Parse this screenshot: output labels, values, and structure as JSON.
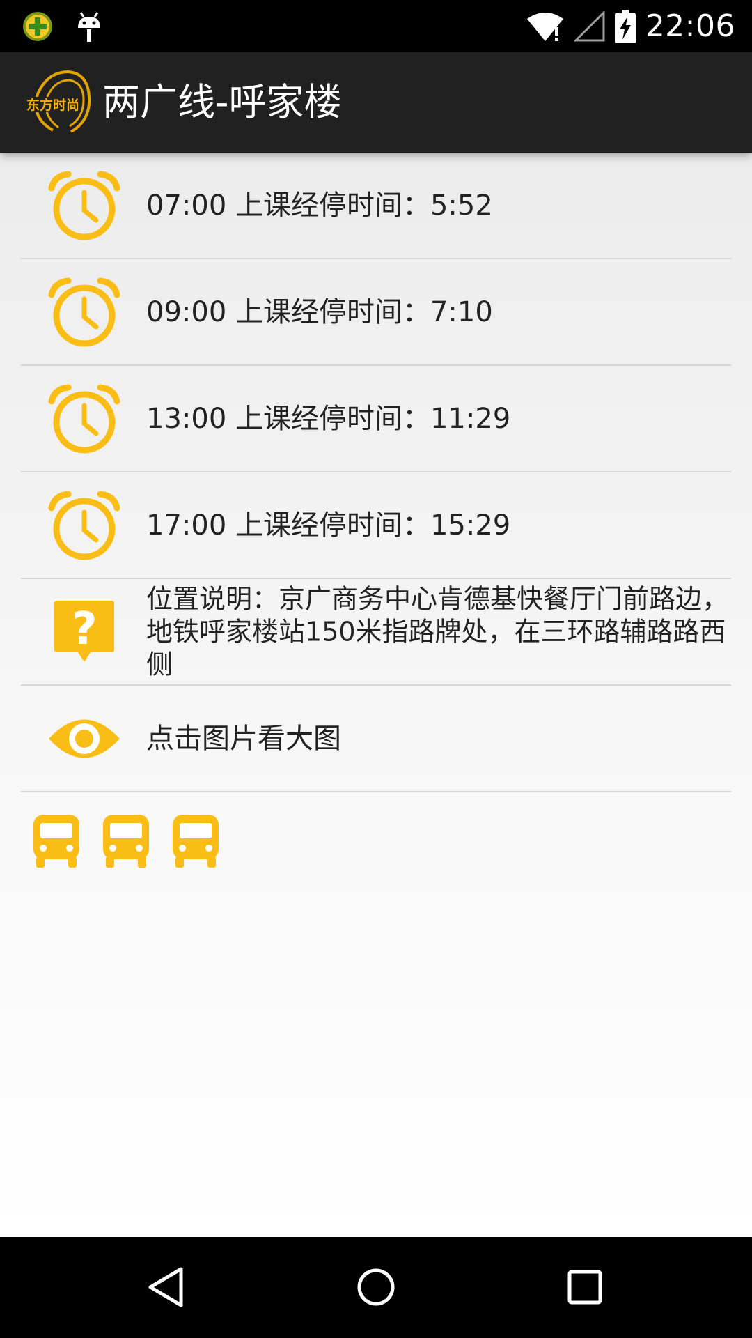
{
  "status_bar": {
    "time": "22:06",
    "icons": [
      "plus-circle-icon",
      "android-icon",
      "wifi-icon",
      "signal-icon",
      "battery-charging-icon"
    ]
  },
  "action_bar": {
    "logo": "app-logo",
    "title": "两广线-呼家楼"
  },
  "schedule": [
    {
      "icon": "alarm-clock-icon",
      "text": "07:00 上课经停时间：5:52"
    },
    {
      "icon": "alarm-clock-icon",
      "text": "09:00 上课经停时间：7:10"
    },
    {
      "icon": "alarm-clock-icon",
      "text": "13:00 上课经停时间：11:29"
    },
    {
      "icon": "alarm-clock-icon",
      "text": "17:00 上课经停时间：15:29"
    }
  ],
  "location": {
    "icon": "question-bubble-icon",
    "text": "位置说明：京广商务中心肯德基快餐厅门前路边，地铁呼家楼站150米指路牌处，在三环路辅路路西侧"
  },
  "view_image": {
    "icon": "eye-icon",
    "text": "点击图片看大图"
  },
  "bus_images": [
    "bus-icon",
    "bus-icon",
    "bus-icon"
  ],
  "nav_bar": [
    "back-icon",
    "home-icon",
    "recents-icon"
  ],
  "colors": {
    "accent": "#F9BD16",
    "action_bar": "#212121",
    "status_bar": "#000000"
  }
}
